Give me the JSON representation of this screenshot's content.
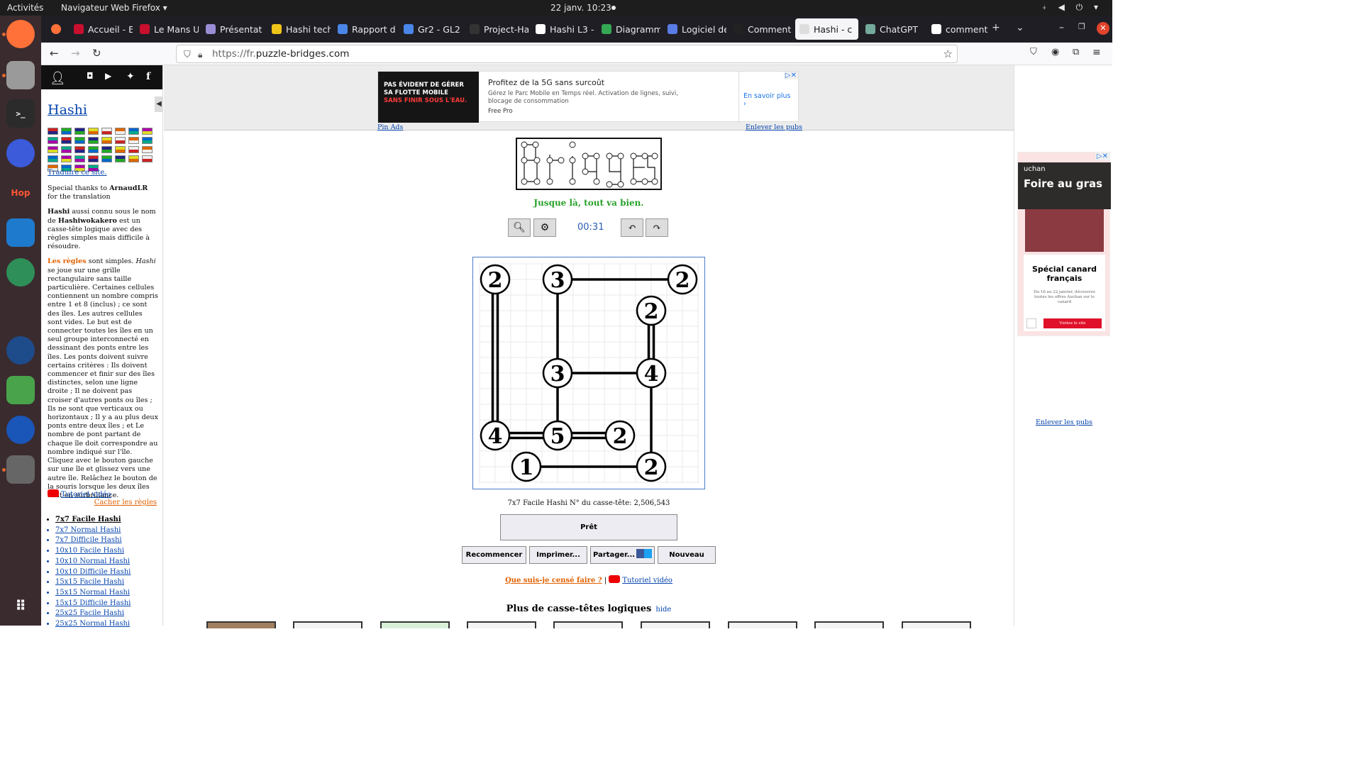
{
  "os": {
    "activities": "Activités",
    "app_name": "Navigateur Web Firefox ▾",
    "clock": "22 janv.  10:23",
    "systray": "⍖ ◀ ⏻ ▾"
  },
  "tabs": [
    {
      "label": "Accueil - E",
      "color": "#c8102e"
    },
    {
      "label": "Le Mans U",
      "color": "#c8102e"
    },
    {
      "label": "Présentat",
      "color": "#9b8cd6"
    },
    {
      "label": "Hashi tech",
      "color": "#f0c419"
    },
    {
      "label": "Rapport d",
      "color": "#4a86e8"
    },
    {
      "label": "Gr2 - GL2 ·",
      "color": "#4a86e8"
    },
    {
      "label": "Project-Ha",
      "color": "#333333"
    },
    {
      "label": "Hashi L3 -",
      "color": "#ffffff"
    },
    {
      "label": "Diagramm",
      "color": "#34a853"
    },
    {
      "label": "Logiciel de",
      "color": "#5b7ce6"
    },
    {
      "label": "Comment",
      "color": "#222222"
    },
    {
      "label": "Hashi - c",
      "color": "#dddddd",
      "active": true
    },
    {
      "label": "ChatGPT",
      "color": "#74aa9c"
    },
    {
      "label": "comment",
      "color": "#ffffff"
    }
  ],
  "browser": {
    "url_prefix": "https://fr.",
    "url_host": "puzzle-bridges.com"
  },
  "sidebar": {
    "title": "Hashi",
    "translate": "Traduire ce site.",
    "thanks_pre": "Special thanks to ",
    "thanks_name": "ArnaudLR",
    "thanks_post": " for the translation",
    "intro_1": "Hashi",
    "intro_2": " aussi connu sous le nom de ",
    "intro_3": "Hashiwokakero",
    "intro_4": " est un casse-tête logique avec des règles simples mais difficile à résoudre.",
    "rules_link": "Les règles",
    "rules_1": " sont simples. ",
    "rules_2": "Hashi",
    "rules_3": " se joue sur une grille rectangulaire sans taille particulière. Certaines cellules contiennent un nombre compris entre 1 et 8 (inclus) ; ce sont des îles. Les autres cellules sont vides. Le but est de connecter toutes les îles en un seul groupe interconnecté en dessinant des ponts entre les îles. Les ponts doivent suivre certains critères : Ils doivent commencer et finir sur des îles distinctes, selon une ligne droite ; Il ne doivent pas croiser d'autres ponts ou îles ; Ils ne sont que verticaux ou horizontaux ; Il y a au plus deux ponts entre deux îles ; et Le nombre de pont partant de chaque île doit correspondre au nombre indiqué sur l'île.",
    "rules_4": "Cliquez avec le bouton gauche sur une île et glissez vers une autre île. Relâchez le bouton de la souris lorsque les deux îles sont en surbrillance.",
    "video": "Tutoriel vidéo",
    "hide_rules": "Cacher les règles",
    "variants": [
      "7x7 Facile Hashi",
      "7x7 Normal Hashi",
      "7x7 Difficile Hashi",
      "10x10 Facile Hashi",
      "10x10 Normal Hashi",
      "10x10 Difficile Hashi",
      "15x15 Facile Hashi",
      "15x15 Normal Hashi",
      "15x15 Difficile Hashi",
      "25x25 Facile Hashi",
      "25x25 Normal Hashi"
    ]
  },
  "ad_top": {
    "image_line1": "PAS ÉVIDENT DE GÉRER",
    "image_line2": "SA FLOTTE MOBILE",
    "image_line3": "SANS FINIR SOUS L'EAU.",
    "title": "Profitez de la 5G sans surcoût",
    "desc": "Gérez le Parc Mobile en Temps réel. Activation de lignes, suivi, blocage de consommation",
    "brand": "Free Pro",
    "cta": "En savoir plus ›",
    "pin": "Pin Ads",
    "remove": "Enlever les pubs"
  },
  "game": {
    "status": "Jusque là, tout va bien.",
    "timer": "00:31",
    "grid_size": 7,
    "islands": [
      {
        "r": 0,
        "c": 0,
        "n": 2
      },
      {
        "r": 0,
        "c": 2,
        "n": 3
      },
      {
        "r": 0,
        "c": 6,
        "n": 2
      },
      {
        "r": 1,
        "c": 5,
        "n": 2
      },
      {
        "r": 3,
        "c": 2,
        "n": 3
      },
      {
        "r": 3,
        "c": 5,
        "n": 4
      },
      {
        "r": 5,
        "c": 0,
        "n": 4
      },
      {
        "r": 5,
        "c": 2,
        "n": 5
      },
      {
        "r": 5,
        "c": 4,
        "n": 2
      },
      {
        "r": 6,
        "c": 1,
        "n": 1
      },
      {
        "r": 6,
        "c": 5,
        "n": 2
      }
    ],
    "bridges": [
      {
        "a": [
          0,
          0
        ],
        "b": [
          5,
          0
        ],
        "count": 2
      },
      {
        "a": [
          0,
          2
        ],
        "b": [
          0,
          6
        ],
        "count": 1
      },
      {
        "a": [
          0,
          2
        ],
        "b": [
          3,
          2
        ],
        "count": 1
      },
      {
        "a": [
          1,
          5
        ],
        "b": [
          3,
          5
        ],
        "count": 2
      },
      {
        "a": [
          3,
          2
        ],
        "b": [
          3,
          5
        ],
        "count": 1
      },
      {
        "a": [
          3,
          2
        ],
        "b": [
          5,
          2
        ],
        "count": 1
      },
      {
        "a": [
          3,
          5
        ],
        "b": [
          6,
          5
        ],
        "count": 1
      },
      {
        "a": [
          5,
          0
        ],
        "b": [
          5,
          2
        ],
        "count": 2
      },
      {
        "a": [
          5,
          2
        ],
        "b": [
          5,
          4
        ],
        "count": 2
      },
      {
        "a": [
          6,
          1
        ],
        "b": [
          6,
          5
        ],
        "count": 1
      }
    ],
    "puzzle_info": "7x7 Facile Hashi N° du casse-tête: 2,506,543",
    "ready": "Prêt",
    "restart": "Recommencer",
    "print": "Imprimer...",
    "share": "Partager...",
    "new": "Nouveau",
    "what": "Que suis-je censé faire ?",
    "sep": " | ",
    "video": "Tutoriel vidéo",
    "more": "Plus de casse-têtes logiques",
    "more_hide": "hide"
  },
  "ad_right": {
    "brand": "uchan",
    "headline": "Foire au gras",
    "product": "Spécial canard français",
    "fine": "Du 16 au 22 janvier, découvrez toutes les offres Auchan sur le canard",
    "cta": "Visitez le site",
    "remove": "Enlever les pubs"
  }
}
